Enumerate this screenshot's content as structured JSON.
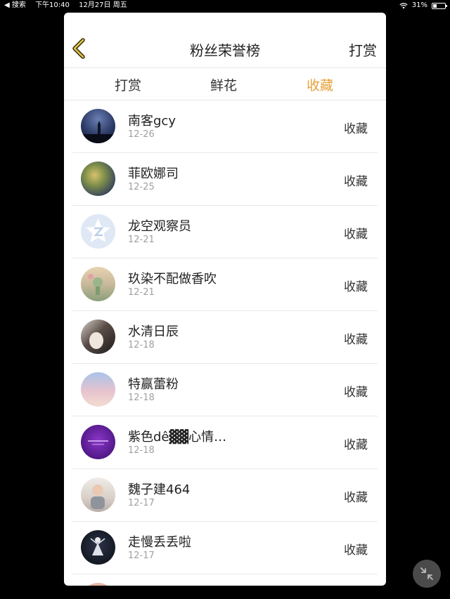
{
  "status_bar": {
    "back_app": "◀ 搜索",
    "time": "下午10:40",
    "date": "12月27日 周五",
    "battery": "31%",
    "battery_level": 0.31
  },
  "header": {
    "title": "粉丝荣誉榜",
    "action_label": "打赏"
  },
  "tabs": [
    {
      "label": "打赏",
      "active": false
    },
    {
      "label": "鲜花",
      "active": false
    },
    {
      "label": "收藏",
      "active": true
    }
  ],
  "accent_color": "#e8a23a",
  "list": [
    {
      "name": "南客gcy",
      "date": "12-26",
      "action": "收藏"
    },
    {
      "name": "菲欧娜司",
      "date": "12-25",
      "action": "收藏"
    },
    {
      "name": "龙空观察员",
      "date": "12-21",
      "action": "收藏"
    },
    {
      "name": "玖染不配做香吹",
      "date": "12-21",
      "action": "收藏"
    },
    {
      "name": "水清日辰",
      "date": "12-18",
      "action": "收藏"
    },
    {
      "name": "特赢蕾粉",
      "date": "12-18",
      "action": "收藏"
    },
    {
      "name": "紫色dê▓▓心情…",
      "date": "12-18",
      "action": "收藏"
    },
    {
      "name": "魏子建464",
      "date": "12-17",
      "action": "收藏"
    },
    {
      "name": "走慢丢丢啦",
      "date": "12-17",
      "action": "收藏"
    }
  ]
}
